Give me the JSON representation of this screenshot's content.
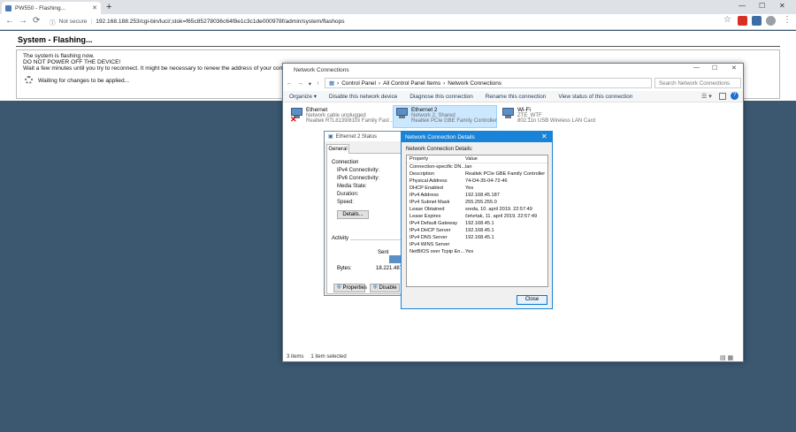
{
  "browser": {
    "tab_title": "PW550 - Flashing...",
    "new_tab": "+",
    "security": "Not secure",
    "url": "192.168.188.253/cgi-bin/luci/;stok=f65c85278036c64f8e1c3c1de000978f/admin/system/flashops",
    "back": "←",
    "forward": "→",
    "reload": "⟳",
    "star": "☆",
    "menu": "⋮",
    "minimize": "—",
    "maximize": "☐",
    "close": "✕"
  },
  "page": {
    "title": "System - Flashing...",
    "line1": "The system is flashing now.",
    "line2": "DO NOT POWER OFF THE DEVICE!",
    "line3": "Wait a few minutes until you try to reconnect. It might be necessary to renew the address of your compu",
    "waiting": "Waiting for changes to be applied..."
  },
  "network_connections": {
    "title": "Network Connections",
    "path": [
      "Control Panel",
      "All Control Panel Items",
      "Network Connections"
    ],
    "search_placeholder": "Search Network Connections",
    "commands": [
      "Organize ▾",
      "Disable this network device",
      "Diagnose this connection",
      "Rename this connection",
      "View status of this connection"
    ],
    "connections": [
      {
        "name": "Ethernet",
        "status": "Network cable unplugged",
        "device": "Realtek RTL8139/810x Family Fast ..."
      },
      {
        "name": "Ethernet 2",
        "status": "Network 2, Shared",
        "device": "Realtek PCIe GBE Family Controller"
      },
      {
        "name": "Wi-Fi",
        "status": "ZTE_WTF",
        "device": "802.11n USB Wireless LAN Card"
      }
    ],
    "items_count": "3 items",
    "selected": "1 item selected"
  },
  "ethernet_status": {
    "title": "Ethernet 2 Status",
    "tab": "General",
    "connection_heading": "Connection",
    "fields": [
      "IPv4 Connectivity:",
      "IPv6 Connectivity:",
      "Media State:",
      "Duration:",
      "Speed:"
    ],
    "details_button": "Details...",
    "activity_heading": "Activity",
    "sent_label": "Sent",
    "bytes_label": "Bytes:",
    "bytes_value": "18.221.487",
    "properties_button": "Properties",
    "disable_button": "Disable"
  },
  "details_dialog": {
    "title": "Network Connection Details",
    "label": "Network Connection Details:",
    "col_property": "Property",
    "col_value": "Value",
    "rows": [
      {
        "p": "Connection-specific DN...",
        "v": "lan"
      },
      {
        "p": "Description",
        "v": "Realtek PCIe GBE Family Controller"
      },
      {
        "p": "Physical Address",
        "v": "74-D4-35-04-72-46"
      },
      {
        "p": "DHCP Enabled",
        "v": "Yes"
      },
      {
        "p": "IPv4 Address",
        "v": "192.168.45.187"
      },
      {
        "p": "IPv4 Subnet Mask",
        "v": "255.255.255.0"
      },
      {
        "p": "Lease Obtained",
        "v": "sreda, 10. april 2019. 22:57:49"
      },
      {
        "p": "Lease Expires",
        "v": "četvrtak, 11. april 2019. 22:57:49"
      },
      {
        "p": "IPv4 Default Gateway",
        "v": "192.168.45.1"
      },
      {
        "p": "IPv4 DHCP Server",
        "v": "192.168.45.1"
      },
      {
        "p": "IPv4 DNS Server",
        "v": "192.168.45.1"
      },
      {
        "p": "IPv4 WINS Server",
        "v": ""
      },
      {
        "p": "NetBIOS over Tcpip En...",
        "v": "Yes"
      }
    ],
    "close_button": "Close"
  }
}
